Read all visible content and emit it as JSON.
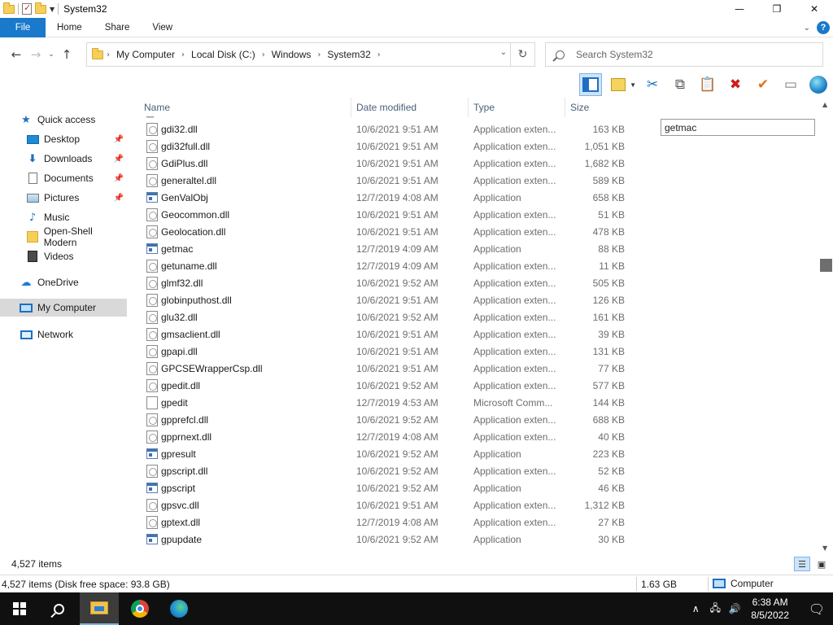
{
  "window": {
    "title": "System32",
    "minimize_glyph": "—",
    "maximize_glyph": "❐",
    "close_glyph": "✕"
  },
  "ribbon": {
    "tabs": [
      {
        "label": "File"
      },
      {
        "label": "Home"
      },
      {
        "label": "Share"
      },
      {
        "label": "View"
      }
    ],
    "help_label": "?",
    "accent_color": "#1979ca"
  },
  "address": {
    "crumbs": [
      "My Computer",
      "Local Disk (C:)",
      "Windows",
      "System32"
    ]
  },
  "search": {
    "placeholder": "Search System32"
  },
  "toolbar": {
    "icons": [
      "layout-icon",
      "new-folder-icon",
      "cut-icon",
      "copy-icon",
      "paste-icon",
      "delete-icon",
      "check-icon",
      "rename-icon",
      "globe-icon"
    ]
  },
  "nav": {
    "items": [
      {
        "label": "Quick access",
        "icon": "star-icon",
        "pinned": false
      },
      {
        "label": "Desktop",
        "icon": "desktop-icon",
        "pinned": true
      },
      {
        "label": "Downloads",
        "icon": "downloads-icon",
        "pinned": true
      },
      {
        "label": "Documents",
        "icon": "documents-icon",
        "pinned": true
      },
      {
        "label": "Pictures",
        "icon": "pictures-icon",
        "pinned": true
      },
      {
        "label": "Music",
        "icon": "music-icon",
        "pinned": false
      },
      {
        "label": "Open-Shell Modern",
        "icon": "folder-icon",
        "pinned": false
      },
      {
        "label": "Videos",
        "icon": "videos-icon",
        "pinned": false
      },
      {
        "label": "OneDrive",
        "icon": "cloud-icon",
        "pinned": false
      },
      {
        "label": "My Computer",
        "icon": "computer-icon",
        "pinned": false,
        "selected": true
      },
      {
        "label": "Network",
        "icon": "network-icon",
        "pinned": false
      }
    ]
  },
  "columns": {
    "name": "Name",
    "date": "Date modified",
    "type": "Type",
    "size": "Size"
  },
  "files": [
    {
      "name": "gdi32.dll",
      "date": "10/6/2021 9:51 AM",
      "type": "Application exten...",
      "size": "163 KB",
      "kind": "dll"
    },
    {
      "name": "gdi32full.dll",
      "date": "10/6/2021 9:51 AM",
      "type": "Application exten...",
      "size": "1,051 KB",
      "kind": "dll"
    },
    {
      "name": "GdiPlus.dll",
      "date": "10/6/2021 9:51 AM",
      "type": "Application exten...",
      "size": "1,682 KB",
      "kind": "dll"
    },
    {
      "name": "generaltel.dll",
      "date": "10/6/2021 9:51 AM",
      "type": "Application exten...",
      "size": "589 KB",
      "kind": "dll"
    },
    {
      "name": "GenValObj",
      "date": "12/7/2019 4:08 AM",
      "type": "Application",
      "size": "658 KB",
      "kind": "exe"
    },
    {
      "name": "Geocommon.dll",
      "date": "10/6/2021 9:51 AM",
      "type": "Application exten...",
      "size": "51 KB",
      "kind": "dll"
    },
    {
      "name": "Geolocation.dll",
      "date": "10/6/2021 9:51 AM",
      "type": "Application exten...",
      "size": "478 KB",
      "kind": "dll"
    },
    {
      "name": "getmac",
      "date": "12/7/2019 4:09 AM",
      "type": "Application",
      "size": "88 KB",
      "kind": "exe"
    },
    {
      "name": "getuname.dll",
      "date": "12/7/2019 4:09 AM",
      "type": "Application exten...",
      "size": "11 KB",
      "kind": "dll"
    },
    {
      "name": "glmf32.dll",
      "date": "10/6/2021 9:52 AM",
      "type": "Application exten...",
      "size": "505 KB",
      "kind": "dll"
    },
    {
      "name": "globinputhost.dll",
      "date": "10/6/2021 9:51 AM",
      "type": "Application exten...",
      "size": "126 KB",
      "kind": "dll"
    },
    {
      "name": "glu32.dll",
      "date": "10/6/2021 9:52 AM",
      "type": "Application exten...",
      "size": "161 KB",
      "kind": "dll"
    },
    {
      "name": "gmsaclient.dll",
      "date": "10/6/2021 9:51 AM",
      "type": "Application exten...",
      "size": "39 KB",
      "kind": "dll"
    },
    {
      "name": "gpapi.dll",
      "date": "10/6/2021 9:51 AM",
      "type": "Application exten...",
      "size": "131 KB",
      "kind": "dll"
    },
    {
      "name": "GPCSEWrapperCsp.dll",
      "date": "10/6/2021 9:51 AM",
      "type": "Application exten...",
      "size": "77 KB",
      "kind": "dll"
    },
    {
      "name": "gpedit.dll",
      "date": "10/6/2021 9:52 AM",
      "type": "Application exten...",
      "size": "577 KB",
      "kind": "dll"
    },
    {
      "name": "gpedit",
      "date": "12/7/2019 4:53 AM",
      "type": "Microsoft Comm...",
      "size": "144 KB",
      "kind": "doc"
    },
    {
      "name": "gpprefcl.dll",
      "date": "10/6/2021 9:52 AM",
      "type": "Application exten...",
      "size": "688 KB",
      "kind": "dll"
    },
    {
      "name": "gpprnext.dll",
      "date": "12/7/2019 4:08 AM",
      "type": "Application exten...",
      "size": "40 KB",
      "kind": "dll"
    },
    {
      "name": "gpresult",
      "date": "10/6/2021 9:52 AM",
      "type": "Application",
      "size": "223 KB",
      "kind": "exe"
    },
    {
      "name": "gpscript.dll",
      "date": "10/6/2021 9:52 AM",
      "type": "Application exten...",
      "size": "52 KB",
      "kind": "dll"
    },
    {
      "name": "gpscript",
      "date": "10/6/2021 9:52 AM",
      "type": "Application",
      "size": "46 KB",
      "kind": "exe"
    },
    {
      "name": "gpsvc.dll",
      "date": "10/6/2021 9:51 AM",
      "type": "Application exten...",
      "size": "1,312 KB",
      "kind": "dll"
    },
    {
      "name": "gptext.dll",
      "date": "12/7/2019 4:08 AM",
      "type": "Application exten...",
      "size": "27 KB",
      "kind": "dll"
    },
    {
      "name": "gpupdate",
      "date": "10/6/2021 9:52 AM",
      "type": "Application",
      "size": "30 KB",
      "kind": "exe"
    }
  ],
  "preview": {
    "input_value": "getmac"
  },
  "status": {
    "item_count": "4,527 items"
  },
  "infobar": {
    "summary": "4,527 items (Disk free space: 93.8 GB)",
    "size": "1.63 GB",
    "location": "Computer"
  },
  "taskbar": {
    "time": "6:38 AM",
    "date": "8/5/2022",
    "apps": [
      "start-icon",
      "search-icon",
      "file-explorer-icon",
      "chrome-icon",
      "edge-icon"
    ]
  }
}
